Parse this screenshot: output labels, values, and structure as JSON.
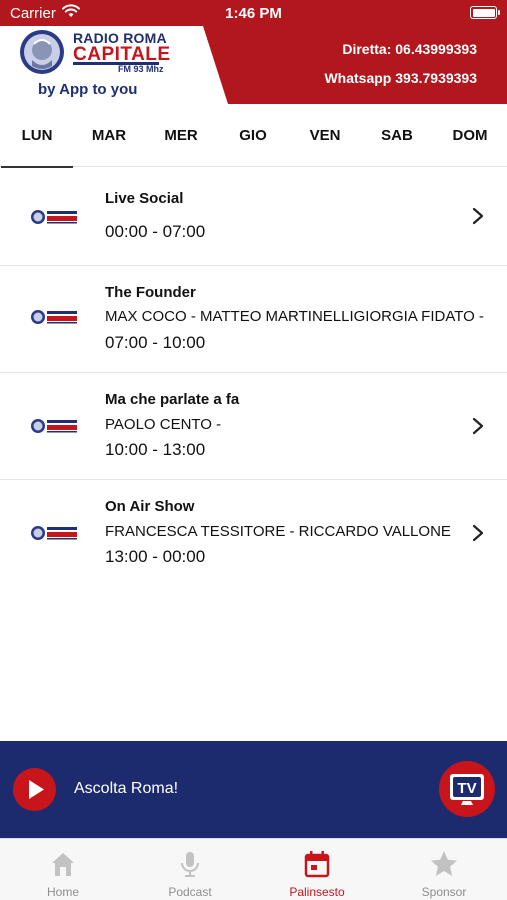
{
  "status_bar": {
    "carrier": "Carrier",
    "time": "1:46 PM"
  },
  "header": {
    "logo_line1": "RADIO ROMA",
    "logo_line2": "CAPITALE",
    "logo_freq": "FM 93 Mhz",
    "tagline": "by App to you",
    "diretta": "Diretta: 06.43999393",
    "whatsapp": "Whatsapp 393.7939393",
    "brand_red": "#b3171e",
    "brand_blue": "#1f2f72"
  },
  "tabs": [
    {
      "label": "LUN",
      "active": true
    },
    {
      "label": "MAR",
      "active": false
    },
    {
      "label": "MER",
      "active": false
    },
    {
      "label": "GIO",
      "active": false
    },
    {
      "label": "VEN",
      "active": false
    },
    {
      "label": "SAB",
      "active": false
    },
    {
      "label": "DOM",
      "active": false
    }
  ],
  "schedule": [
    {
      "title": "Live Social",
      "hosts": "",
      "time": "00:00 - 07:00"
    },
    {
      "title": "The Founder",
      "hosts": "MAX COCO - MATTEO MARTINELLIGIORGIA FIDATO -",
      "time": "07:00 - 10:00"
    },
    {
      "title": "Ma che parlate a fa",
      "hosts": "PAOLO CENTO -",
      "time": "10:00 - 13:00"
    },
    {
      "title": "On Air Show",
      "hosts": "FRANCESCA TESSITORE - RICCARDO VALLONE",
      "time": "13:00 - 00:00"
    }
  ],
  "player": {
    "label": "Ascolta Roma!",
    "tv_label": "TV",
    "bg_color": "#1c2b6e",
    "accent": "#c8151b"
  },
  "bottom_nav": [
    {
      "label": "Home",
      "icon": "home-icon",
      "active": false
    },
    {
      "label": "Podcast",
      "icon": "microphone-icon",
      "active": false
    },
    {
      "label": "Palinsesto",
      "icon": "calendar-icon",
      "active": true
    },
    {
      "label": "Sponsor",
      "icon": "star-icon",
      "active": false
    }
  ]
}
